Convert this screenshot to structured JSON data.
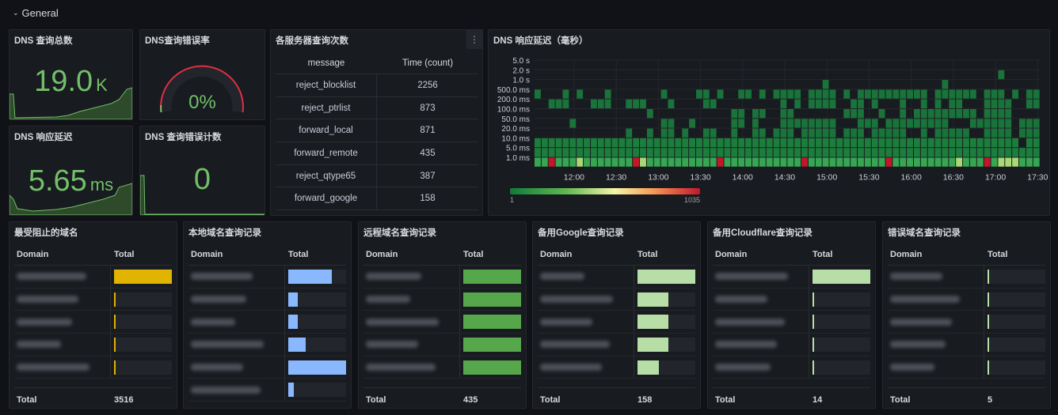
{
  "row": {
    "title": "General",
    "icon": "chevron-down-icon"
  },
  "stats": {
    "total_queries": {
      "title": "DNS 查询总数",
      "value": "19.0",
      "unit": "K",
      "color": "#73bf69"
    },
    "error_rate": {
      "title": "DNS查询错误率",
      "value": "0%",
      "percent": 0,
      "color": "#73bf69"
    },
    "latency": {
      "title": "DNS 响应延迟",
      "value": "5.65",
      "unit": "ms",
      "color": "#73bf69"
    },
    "error_count": {
      "title": "DNS 查询错误计数",
      "value": "0",
      "color": "#73bf69"
    }
  },
  "server_table": {
    "title": "各服务器查询次数",
    "columns": [
      "message",
      "Time (count)"
    ],
    "rows": [
      [
        "reject_blocklist",
        "2256"
      ],
      [
        "reject_ptrlist",
        "873"
      ],
      [
        "forward_local",
        "871"
      ],
      [
        "forward_remote",
        "435"
      ],
      [
        "reject_qtype65",
        "387"
      ],
      [
        "forward_google",
        "158"
      ]
    ]
  },
  "heatmap": {
    "title": "DNS 响应延迟（毫秒）",
    "y_labels": [
      "5.0 s",
      "2.0 s",
      "1.0 s",
      "500.0 ms",
      "200.0 ms",
      "100.0 ms",
      "50.0 ms",
      "20.0 ms",
      "10.0 ms",
      "5.0 ms",
      "1.0 ms"
    ],
    "x_labels": [
      "12:00",
      "12:30",
      "13:00",
      "13:30",
      "14:00",
      "14:30",
      "15:00",
      "15:30",
      "16:00",
      "16:30",
      "17:00",
      "17:30"
    ],
    "legend_min": "1",
    "legend_max": "1035",
    "buckets": [
      {
        "bucket": "2.0 s",
        "cells": [
          66
        ]
      },
      {
        "bucket": "1.0 s",
        "cells": [
          41,
          58
        ]
      },
      {
        "bucket": "500.0 ms",
        "cells": [
          0,
          4,
          6,
          10,
          18,
          23,
          24,
          26,
          29,
          30,
          32,
          34,
          35,
          36,
          37,
          39,
          40,
          41,
          42,
          44,
          46,
          47,
          48,
          49,
          50,
          51,
          52,
          53,
          54,
          55,
          57,
          58,
          59,
          60,
          61,
          62,
          64,
          65,
          66,
          68,
          70,
          71
        ]
      },
      {
        "bucket": "200.0 ms",
        "cells": [
          2,
          3,
          4,
          8,
          9,
          10,
          13,
          14,
          15,
          19,
          24,
          25,
          35,
          37,
          39,
          40,
          41,
          42,
          45,
          46,
          48,
          52,
          55,
          57,
          59,
          60,
          64,
          65,
          66,
          67,
          70,
          71
        ]
      },
      {
        "bucket": "100.0 ms",
        "cells": [
          16,
          28,
          29,
          31,
          32,
          35,
          36,
          44,
          45,
          46,
          49,
          52,
          54,
          55,
          56,
          57,
          58,
          59,
          60,
          61,
          62,
          64,
          65,
          66,
          67
        ]
      },
      {
        "bucket": "50.0 ms",
        "cells": [
          5,
          18,
          19,
          22,
          28,
          29,
          31,
          35,
          36,
          37,
          38,
          39,
          40,
          41,
          42,
          46,
          47,
          48,
          50,
          51,
          52,
          53,
          54,
          55,
          56,
          57,
          58,
          62,
          63,
          64,
          65,
          66,
          67,
          69,
          70,
          71
        ]
      },
      {
        "bucket": "20.0 ms",
        "cells": [
          13,
          16,
          18,
          19,
          21,
          24,
          25,
          28,
          31,
          32,
          34,
          35,
          36,
          38,
          39,
          40,
          41,
          42,
          44,
          45,
          46,
          48,
          49,
          50,
          51,
          52,
          55,
          57,
          58,
          59,
          60,
          61,
          64,
          65,
          66,
          67,
          69,
          70,
          71
        ]
      },
      {
        "bucket": "10.0 ms",
        "levels": "222222222222222222222222222222222222222222222222222222222222222222222022"
      },
      {
        "bucket": "5.0 ms",
        "levels": "222222222222222222222222222222222222222222222222222222222222222222222222"
      },
      {
        "bucket": "1.0 ms",
        "levels": "339333433333339433333333339333333333339333333333339333333333433393444333"
      }
    ],
    "colors": {
      "0": "",
      "1": "#19733a",
      "2": "#1c7e3d",
      "3": "#37a653",
      "4": "#a9d875",
      "9": "#c4162a"
    }
  },
  "domain_tables": [
    {
      "title": "最受阻止的域名",
      "columns": [
        "Domain",
        "Total"
      ],
      "bar_color": "#e0b400",
      "fractions": [
        1.0,
        0.01,
        0.01,
        0.01,
        0.01
      ],
      "footer": [
        "Total",
        "3516"
      ]
    },
    {
      "title": "本地域名查询记录",
      "columns": [
        "Domain",
        "Total"
      ],
      "bar_color": "#8ab8ff",
      "fractions": [
        0.75,
        0.17,
        0.17,
        0.3,
        1.0,
        0.09
      ],
      "footer": null
    },
    {
      "title": "远程域名查询记录",
      "columns": [
        "Domain",
        "Total"
      ],
      "bar_color": "#56a64b",
      "fractions": [
        1.0,
        1.0,
        1.0,
        1.0,
        1.0
      ],
      "footer": [
        "Total",
        "435"
      ]
    },
    {
      "title": "备用Google查询记录",
      "columns": [
        "Domain",
        "Total"
      ],
      "bar_color": "#b8dea8",
      "fractions": [
        1.0,
        0.54,
        0.54,
        0.54,
        0.37
      ],
      "footer": [
        "Total",
        "158"
      ]
    },
    {
      "title": "备用Cloudflare查询记录",
      "columns": [
        "Domain",
        "Total"
      ],
      "bar_color": "#b8dea8",
      "fractions": [
        1.0,
        0.01,
        0.01,
        0.01,
        0.01
      ],
      "footer": [
        "Total",
        "14"
      ]
    },
    {
      "title": "错误域名查询记录",
      "columns": [
        "Domain",
        "Total"
      ],
      "bar_color": "#b8dea8",
      "fractions": [
        0.01,
        0.01,
        0.01,
        0.01,
        0.01
      ],
      "footer": [
        "Total",
        "5"
      ]
    }
  ]
}
